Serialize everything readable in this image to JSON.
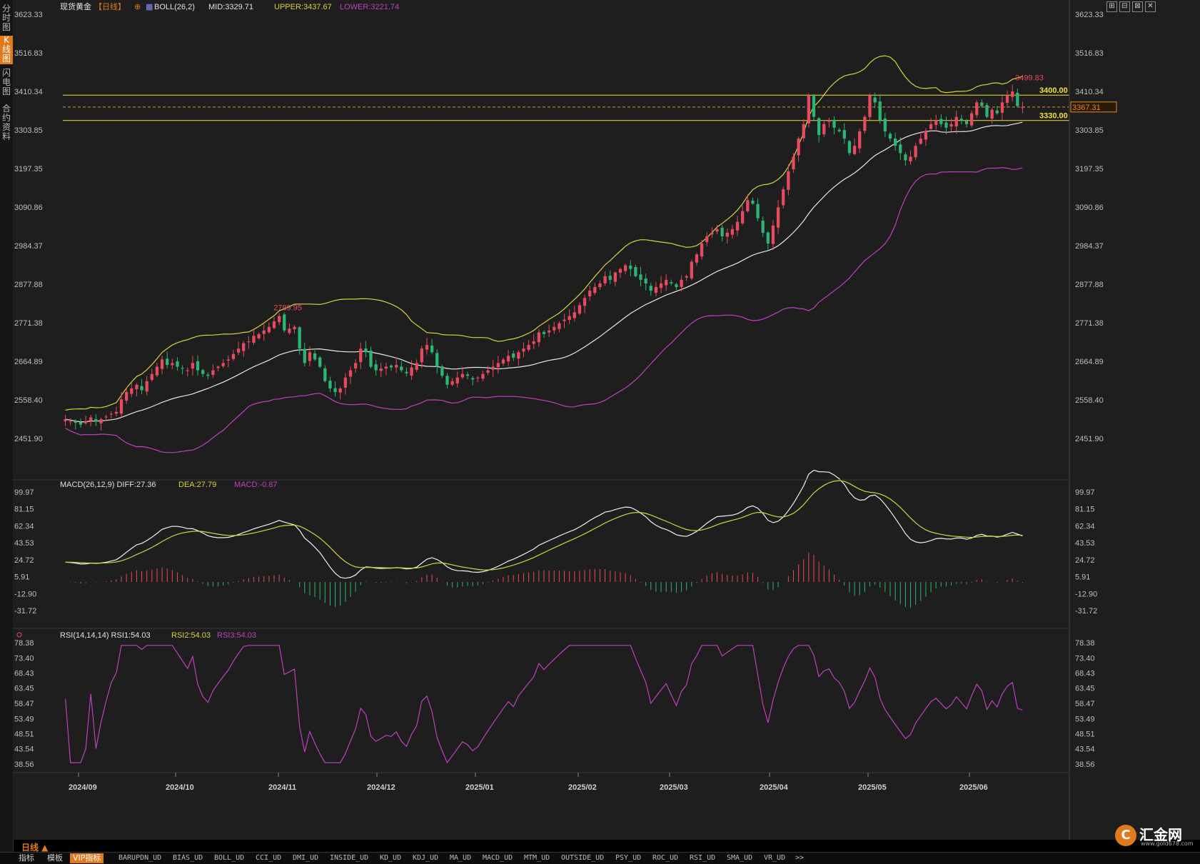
{
  "sidebar": {
    "tabs": [
      {
        "label": "分时图",
        "active": false
      },
      {
        "label": "K线图",
        "active": true
      },
      {
        "label": "闪电图",
        "active": false
      },
      {
        "label": "合约资料",
        "active": false
      }
    ]
  },
  "header": {
    "symbol": "现货黄金",
    "period_tag": "【日线】",
    "settings_icon": "⊕",
    "boll_label": "BOLL(26,2)",
    "boll_mid": "MID:3329.71",
    "boll_upper": "UPPER:3437.67",
    "boll_lower": "LOWER:3221.74"
  },
  "window_controls": [
    "⊞",
    "⊟",
    "⊠",
    "✕"
  ],
  "price_axis": [
    "3623.33",
    "3516.83",
    "3410.34",
    "3303.85",
    "3197.35",
    "3090.86",
    "2984.37",
    "2877.88",
    "2771.38",
    "2664.89",
    "2558.40",
    "2451.90"
  ],
  "price_markers": {
    "line_3400": "3400.00",
    "line_3330": "3330.00",
    "current": "3367.31",
    "high_label": "3499.83",
    "mid_label": "2789.95"
  },
  "macd": {
    "label": "MACD(26,12,9)",
    "diff": "DIFF:27.36",
    "dea": "DEA:27.79",
    "macd": "MACD:-0.87",
    "axis": [
      "99.97",
      "81.15",
      "62.34",
      "43.53",
      "24.72",
      "5.91",
      "-12.90",
      "-31.72"
    ]
  },
  "rsi": {
    "label": "RSI(14,14,14)",
    "rsi1": "RSI1:54.03",
    "rsi2": "RSI2:54.03",
    "rsi3": "RSI3:54.03",
    "axis": [
      "78.38",
      "73.40",
      "68.43",
      "63.45",
      "58.47",
      "53.49",
      "48.51",
      "43.54",
      "38.56"
    ]
  },
  "date_axis": [
    "2024/09",
    "2024/10",
    "2024/11",
    "2024/12",
    "2025/01",
    "2025/02",
    "2025/03",
    "2025/04",
    "2025/05",
    "2025/06"
  ],
  "period_button": "日线 ▲",
  "bottom": {
    "tabs": [
      "指标",
      "模板"
    ],
    "vip": "VIP指标",
    "indicators": [
      "BARUPDN_UD",
      "BIAS_UD",
      "BOLL_UD",
      "CCI_UD",
      "DMI_UD",
      "INSIDE_UD",
      "KD_UD",
      "KDJ_UD",
      "MA_UD",
      "MACD_UD",
      "MTM_UD",
      "OUTSIDE_UD",
      "PSY_UD",
      "ROC_UD",
      "RSI_UD",
      "SMA_UD",
      "VR_UD",
      ">>"
    ]
  },
  "logo": {
    "mark": "C",
    "name": "汇金网",
    "url": "www.gold678.com"
  },
  "colors": {
    "up": "#e84a5f",
    "down": "#2bb673",
    "upper": "#d4d43a",
    "mid": "#e8e8e8",
    "lower": "#c040c0",
    "hline": "#f0e040",
    "price_label": "#e08a2a"
  },
  "chart_data": {
    "type": "candlestick",
    "title": "现货黄金 日线",
    "ylim": [
      2451.9,
      3623.33
    ],
    "x_labels": [
      "2024/09",
      "2024/10",
      "2024/11",
      "2024/12",
      "2025/01",
      "2025/02",
      "2025/03",
      "2025/04",
      "2025/05",
      "2025/06"
    ],
    "horizontal_lines": [
      3400.0,
      3330.0
    ],
    "current_price": 3367.31,
    "annotated_high": 3499.83,
    "annotated_point": 2789.95,
    "close_series": [
      2505,
      2500,
      2495,
      2490,
      2500,
      2510,
      2498,
      2505,
      2512,
      2520,
      2525,
      2560,
      2580,
      2590,
      2600,
      2585,
      2610,
      2630,
      2650,
      2670,
      2655,
      2660,
      2650,
      2645,
      2640,
      2660,
      2640,
      2630,
      2625,
      2640,
      2650,
      2660,
      2670,
      2685,
      2700,
      2715,
      2720,
      2735,
      2740,
      2750,
      2760,
      2775,
      2790,
      2750,
      2755,
      2760,
      2700,
      2660,
      2690,
      2670,
      2650,
      2610,
      2590,
      2580,
      2590,
      2620,
      2640,
      2660,
      2700,
      2690,
      2650,
      2640,
      2645,
      2650,
      2648,
      2655,
      2640,
      2632,
      2648,
      2660,
      2700,
      2710,
      2690,
      2650,
      2625,
      2600,
      2610,
      2620,
      2630,
      2625,
      2615,
      2620,
      2630,
      2640,
      2650,
      2660,
      2670,
      2680,
      2675,
      2690,
      2700,
      2710,
      2720,
      2745,
      2740,
      2750,
      2760,
      2770,
      2780,
      2790,
      2800,
      2820,
      2840,
      2860,
      2870,
      2880,
      2900,
      2890,
      2910,
      2920,
      2930,
      2920,
      2900,
      2890,
      2880,
      2860,
      2870,
      2880,
      2890,
      2880,
      2870,
      2890,
      2900,
      2940,
      2960,
      2990,
      3010,
      3020,
      3030,
      3010,
      3020,
      3030,
      3050,
      3080,
      3110,
      3100,
      3060,
      3020,
      2990,
      3040,
      3090,
      3140,
      3190,
      3230,
      3280,
      3320,
      3400,
      3340,
      3290,
      3320,
      3330,
      3310,
      3300,
      3280,
      3240,
      3260,
      3300,
      3340,
      3400,
      3380,
      3330,
      3300,
      3280,
      3260,
      3240,
      3220,
      3230,
      3260,
      3280,
      3300,
      3320,
      3330,
      3320,
      3310,
      3320,
      3340,
      3330,
      3320,
      3350,
      3380,
      3370,
      3340,
      3360,
      3350,
      3380,
      3400,
      3410,
      3370,
      3367
    ]
  }
}
